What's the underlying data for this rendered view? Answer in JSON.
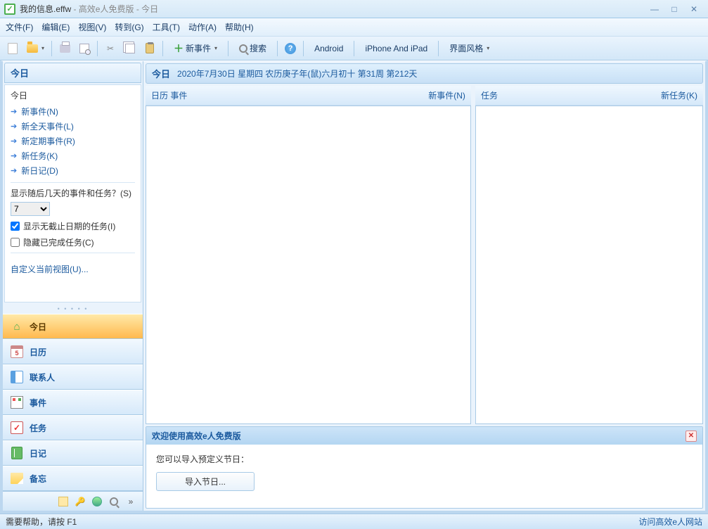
{
  "titlebar": {
    "app_icon_glyph": "✓",
    "title_main": "我的信息.effw",
    "title_suffix": " - 高效e人免费版 - 今日"
  },
  "menu": {
    "file": "文件(F)",
    "edit": "编辑(E)",
    "view": "视图(V)",
    "goto": "转到(G)",
    "tools": "工具(T)",
    "actions": "动作(A)",
    "help": "帮助(H)"
  },
  "toolbar": {
    "new_event": "新事件",
    "search": "搜索",
    "android": "Android",
    "iphone": "iPhone And iPad",
    "theme": "界面风格",
    "help_glyph": "?"
  },
  "sidebar": {
    "header": "今日",
    "section_label": "今日",
    "links": {
      "new_event": "新事件(N)",
      "new_allday": "新全天事件(L)",
      "new_recurring": "新定期事件(R)",
      "new_task": "新任务(K)",
      "new_diary": "新日记(D)"
    },
    "days_question": "显示随后几天的事件和任务？(S)",
    "days_value": "7",
    "chk_no_deadline": "显示无截止日期的任务(I)",
    "chk_hide_done": "隐藏已完成任务(C)",
    "custom_view": "自定义当前视图(U)..."
  },
  "nav": {
    "today": "今日",
    "calendar": "日历",
    "contacts": "联系人",
    "events": "事件",
    "tasks": "任务",
    "diary": "日记",
    "memo": "备忘"
  },
  "today_bar": {
    "label": "今日",
    "date": "2020年7月30日 星期四 农历庚子年(鼠)六月初十  第31周 第212天"
  },
  "panels": {
    "calendar_events_label": "日历  事件",
    "new_event_link": "新事件(N)",
    "tasks_label": "任务",
    "new_task_link": "新任务(K)"
  },
  "welcome": {
    "title": "欢迎使用高效e人免费版",
    "text": "您可以导入预定义节日：",
    "button": "导入节日..."
  },
  "statusbar": {
    "help": "需要帮助，请按 F1",
    "site_link": "访问高效e人网站"
  }
}
